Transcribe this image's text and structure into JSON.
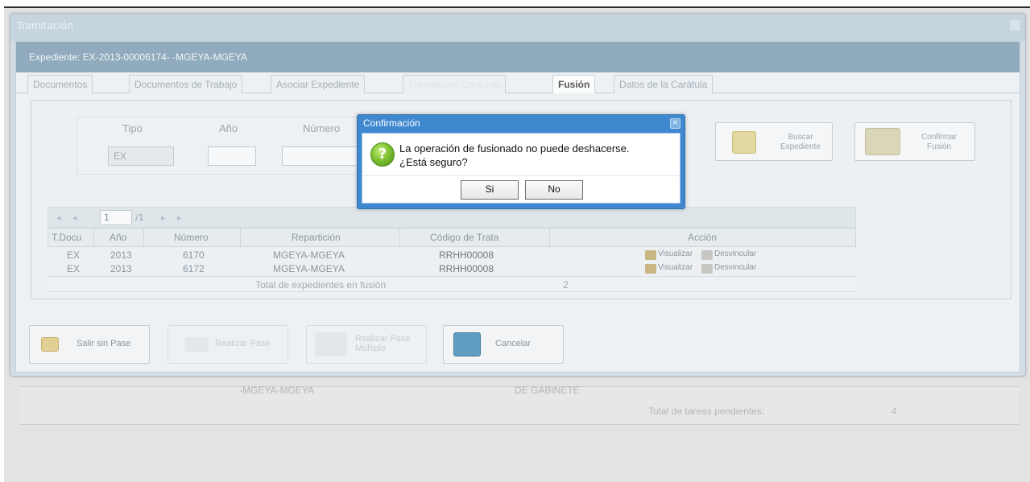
{
  "background": {
    "repartition": "-MGEYA-MGEYA",
    "dept": "DE GABINETE",
    "total_label": "Total de tareas pendientes:",
    "total_value": "4"
  },
  "window": {
    "title": "Tramitación",
    "expediente": "Expediente: EX-2013-00006174- -MGEYA-MGEYA"
  },
  "tabs": [
    {
      "label": "Documentos"
    },
    {
      "label": "Documentos de Trabajo"
    },
    {
      "label": "Asociar Expediente"
    },
    {
      "label": "Tramitación Conjunta"
    },
    {
      "label": "Fusión"
    },
    {
      "label": "Datos de la Carátula"
    }
  ],
  "search": {
    "tipo_label": "Tipo",
    "anio_label": "Año",
    "numero_label": "Número",
    "tipo_value": "EX",
    "anio_value": "",
    "numero_value": ""
  },
  "buttons": {
    "buscar": "Buscar Expediente",
    "confirmar": "Confirmar Fusión"
  },
  "pager": {
    "page": "1",
    "of": "/1"
  },
  "grid": {
    "headers": [
      "T.Docu",
      "Año",
      "Número",
      "Repartición",
      "Código de Trata",
      "Acción"
    ],
    "rows": [
      {
        "tipo": "EX",
        "anio": "2013",
        "numero": "6170",
        "reparticion": "MGEYA-MGEYA",
        "codigo": "RRHH00008"
      },
      {
        "tipo": "EX",
        "anio": "2013",
        "numero": "6172",
        "reparticion": "MGEYA-MGEYA",
        "codigo": "RRHH00008"
      }
    ],
    "action_view": "Visualizar",
    "action_unlink": "Desvincular",
    "total_label": "Total de expedientes en fusión",
    "total_value": "2"
  },
  "bottom": {
    "salir": "Salir sin Pase",
    "realizar": "Realizar Pase",
    "realizar_multiple": "Realizar Pase Múltiple",
    "cancelar": "Cancelar"
  },
  "dialog": {
    "title": "Confirmación",
    "message_line1": "La operación de fusionado no puede deshacerse.",
    "message_line2": "¿Está seguro?",
    "yes": "Si",
    "no": "No",
    "close": "×"
  },
  "colors": {
    "dialog_title_bar": "#3f88cf",
    "header_bar": "#8fabbd",
    "question_icon": "#7fc232"
  }
}
